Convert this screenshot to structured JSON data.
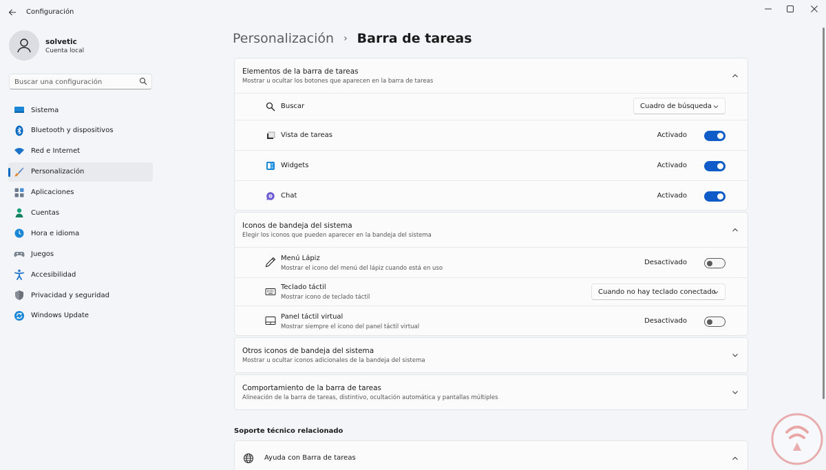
{
  "window": {
    "title": "Configuración",
    "back_icon": "arrow-left-icon",
    "controls": [
      "minimize-icon",
      "maximize-icon",
      "close-icon"
    ]
  },
  "profile": {
    "name": "solvetic",
    "account_type": "Cuenta local"
  },
  "search": {
    "placeholder": "Buscar una configuración"
  },
  "sidebar": {
    "items": [
      {
        "label": "Sistema",
        "icon": "monitor-icon",
        "color": "#0078d4"
      },
      {
        "label": "Bluetooth y dispositivos",
        "icon": "bluetooth-icon",
        "color": "#0067c0"
      },
      {
        "label": "Red e Internet",
        "icon": "wifi-icon",
        "color": "#0067c0"
      },
      {
        "label": "Personalización",
        "icon": "brush-icon",
        "color": "#e3892b",
        "active": true
      },
      {
        "label": "Aplicaciones",
        "icon": "apps-icon",
        "color": "#5d6b7d"
      },
      {
        "label": "Cuentas",
        "icon": "person-icon",
        "color": "#19a078"
      },
      {
        "label": "Hora e idioma",
        "icon": "globe-clock-icon",
        "color": "#0078d4"
      },
      {
        "label": "Juegos",
        "icon": "gamepad-icon",
        "color": "#7a7a7a"
      },
      {
        "label": "Accesibilidad",
        "icon": "accessibility-icon",
        "color": "#1a73c9"
      },
      {
        "label": "Privacidad y seguridad",
        "icon": "shield-icon",
        "color": "#7a7f87"
      },
      {
        "label": "Windows Update",
        "icon": "update-icon",
        "color": "#0078d4"
      }
    ]
  },
  "breadcrumb": {
    "parent": "Personalización",
    "separator": "›",
    "current": "Barra de tareas"
  },
  "taskbar_items": {
    "title": "Elementos de la barra de tareas",
    "subtitle": "Mostrar u ocultar los botones que aparecen en la barra de tareas",
    "rows": [
      {
        "label": "Buscar",
        "icon": "search-icon",
        "dropdown_value": "Cuadro de búsqueda"
      },
      {
        "label": "Vista de tareas",
        "icon": "task-view-icon",
        "state": "Activado"
      },
      {
        "label": "Widgets",
        "icon": "widgets-icon",
        "state": "Activado"
      },
      {
        "label": "Chat",
        "icon": "chat-icon",
        "state": "Activado"
      }
    ]
  },
  "tray_icons": {
    "title": "Iconos de bandeja del sistema",
    "subtitle": "Elegir los iconos que pueden aparecer en la bandeja del sistema",
    "rows": [
      {
        "label": "Menú Lápiz",
        "sub": "Mostrar el icono del menú del lápiz cuando está en uso",
        "icon": "pen-icon",
        "state": "Desactivado"
      },
      {
        "label": "Teclado táctil",
        "sub": "Mostrar icono de teclado táctil",
        "icon": "keyboard-icon",
        "dropdown_value": "Cuando no hay teclado conectado"
      },
      {
        "label": "Panel táctil virtual",
        "sub": "Mostrar siempre el icono del panel táctil virtual",
        "icon": "touchpad-icon",
        "state": "Desactivado"
      }
    ]
  },
  "other_tray": {
    "title": "Otros iconos de bandeja del sistema",
    "subtitle": "Mostrar u ocultar iconos adicionales de la bandeja del sistema"
  },
  "behavior": {
    "title": "Comportamiento de la barra de tareas",
    "subtitle": "Alineación de la barra de tareas, distintivo, ocultación automática y pantallas múltiples"
  },
  "support": {
    "heading": "Soporte técnico relacionado",
    "item_label": "Ayuda con Barra de tareas"
  },
  "colors": {
    "accent": "#0f5bc7",
    "background": "#f3f5f9",
    "card": "#fbfbfc"
  }
}
